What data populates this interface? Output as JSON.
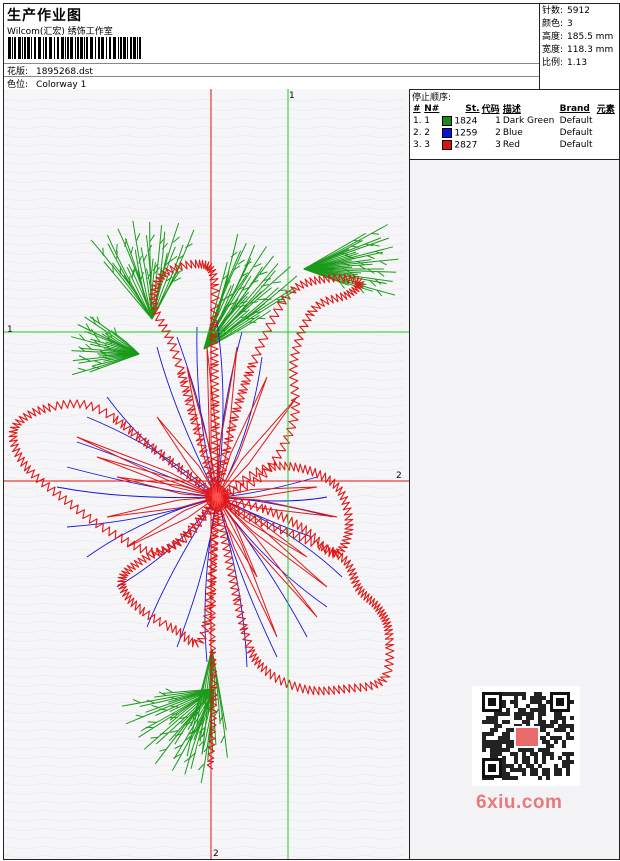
{
  "header": {
    "title": "生产作业图",
    "company": "Wilcom(汇宏) 绣饰工作室",
    "design_label": "花版:",
    "design_value": "1895268.dst",
    "colorway_label": "色位:",
    "colorway_value": "Colorway 1"
  },
  "stats": {
    "stitches_label": "针数:",
    "stitches_value": "5912",
    "colors_label": "颜色:",
    "colors_value": "3",
    "height_label": "高度:",
    "height_value": "185.5 mm",
    "width_label": "宽度:",
    "width_value": "118.3 mm",
    "ratio_label": "比例:",
    "ratio_value": "1.13"
  },
  "stop_sequence": {
    "caption": "停止顺序:",
    "columns": [
      "#",
      "N#",
      "St.",
      "代码",
      "描述",
      "Brand",
      "元素"
    ],
    "rows": [
      {
        "idx": "1.",
        "n": "1",
        "st": "1824",
        "code": "1",
        "desc": "Dark Green",
        "brand": "Default",
        "color": "#1a8a1a"
      },
      {
        "idx": "2.",
        "n": "2",
        "st": "1259",
        "code": "2",
        "desc": "Blue",
        "brand": "Default",
        "color": "#1010e0"
      },
      {
        "idx": "3.",
        "n": "3",
        "st": "2827",
        "code": "3",
        "desc": "Red",
        "brand": "Default",
        "color": "#e01010"
      }
    ]
  },
  "axes": {
    "v1_label": "1",
    "h1_label": "1",
    "h2_label": "2",
    "v2_label": "2"
  },
  "watermark": {
    "site": "6xiu.com",
    "qr_icon": "qr-code-icon"
  },
  "colors": {
    "green": "#1a9a1a",
    "blue": "#1515d8",
    "red": "#e01818",
    "axis_green": "#22cc22",
    "axis_red": "#dd1111"
  }
}
